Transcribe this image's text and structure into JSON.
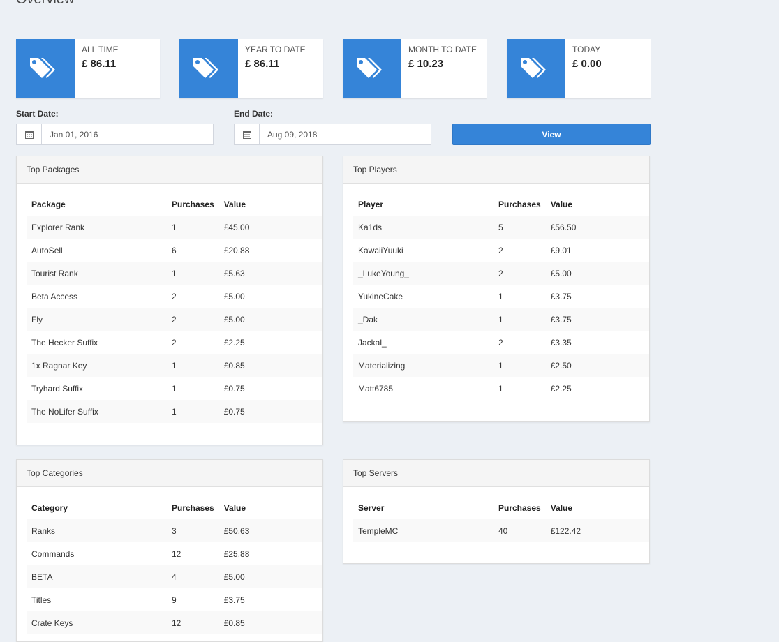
{
  "page": {
    "title": "Overview"
  },
  "stats": [
    {
      "label": "ALL TIME",
      "value": "£ 86.11",
      "icon": "tags-icon"
    },
    {
      "label": "YEAR TO DATE",
      "value": "£ 86.11",
      "icon": "tags-icon"
    },
    {
      "label": "MONTH TO DATE",
      "value": "£ 10.23",
      "icon": "tags-icon"
    },
    {
      "label": "TODAY",
      "value": "£ 0.00",
      "icon": "tags-icon"
    }
  ],
  "filters": {
    "start_label": "Start Date:",
    "start_value": "Jan 01, 2016",
    "end_label": "End Date:",
    "end_value": "Aug 09, 2018",
    "view_label": "View"
  },
  "top_packages": {
    "title": "Top Packages",
    "columns": [
      "Package",
      "Purchases",
      "Value"
    ],
    "rows": [
      [
        "Explorer Rank",
        "1",
        "£45.00"
      ],
      [
        "AutoSell",
        "6",
        "£20.88"
      ],
      [
        "Tourist Rank",
        "1",
        "£5.63"
      ],
      [
        "Beta Access",
        "2",
        "£5.00"
      ],
      [
        "Fly",
        "2",
        "£5.00"
      ],
      [
        "The Hecker Suffix",
        "2",
        "£2.25"
      ],
      [
        "1x Ragnar Key",
        "1",
        "£0.85"
      ],
      [
        "Tryhard Suffix",
        "1",
        "£0.75"
      ],
      [
        "The NoLifer Suffix",
        "1",
        "£0.75"
      ]
    ]
  },
  "top_players": {
    "title": "Top Players",
    "columns": [
      "Player",
      "Purchases",
      "Value"
    ],
    "rows": [
      [
        "Ka1ds",
        "5",
        "£56.50"
      ],
      [
        "KawaiiYuuki",
        "2",
        "£9.01"
      ],
      [
        "_LukeYoung_",
        "2",
        "£5.00"
      ],
      [
        "YukineCake",
        "1",
        "£3.75"
      ],
      [
        "_Dak",
        "1",
        "£3.75"
      ],
      [
        "Jackal_",
        "2",
        "£3.35"
      ],
      [
        "Materializing",
        "1",
        "£2.50"
      ],
      [
        "Matt6785",
        "1",
        "£2.25"
      ]
    ]
  },
  "top_categories": {
    "title": "Top Categories",
    "columns": [
      "Category",
      "Purchases",
      "Value"
    ],
    "rows": [
      [
        "Ranks",
        "3",
        "£50.63"
      ],
      [
        "Commands",
        "12",
        "£25.88"
      ],
      [
        "BETA",
        "4",
        "£5.00"
      ],
      [
        "Titles",
        "9",
        "£3.75"
      ],
      [
        "Crate Keys",
        "12",
        "£0.85"
      ]
    ]
  },
  "top_servers": {
    "title": "Top Servers",
    "columns": [
      "Server",
      "Purchases",
      "Value"
    ],
    "rows": [
      [
        "TempleMC",
        "40",
        "£122.42"
      ]
    ]
  },
  "colors": {
    "accent": "#3584d8",
    "background": "#ecf0f5"
  }
}
